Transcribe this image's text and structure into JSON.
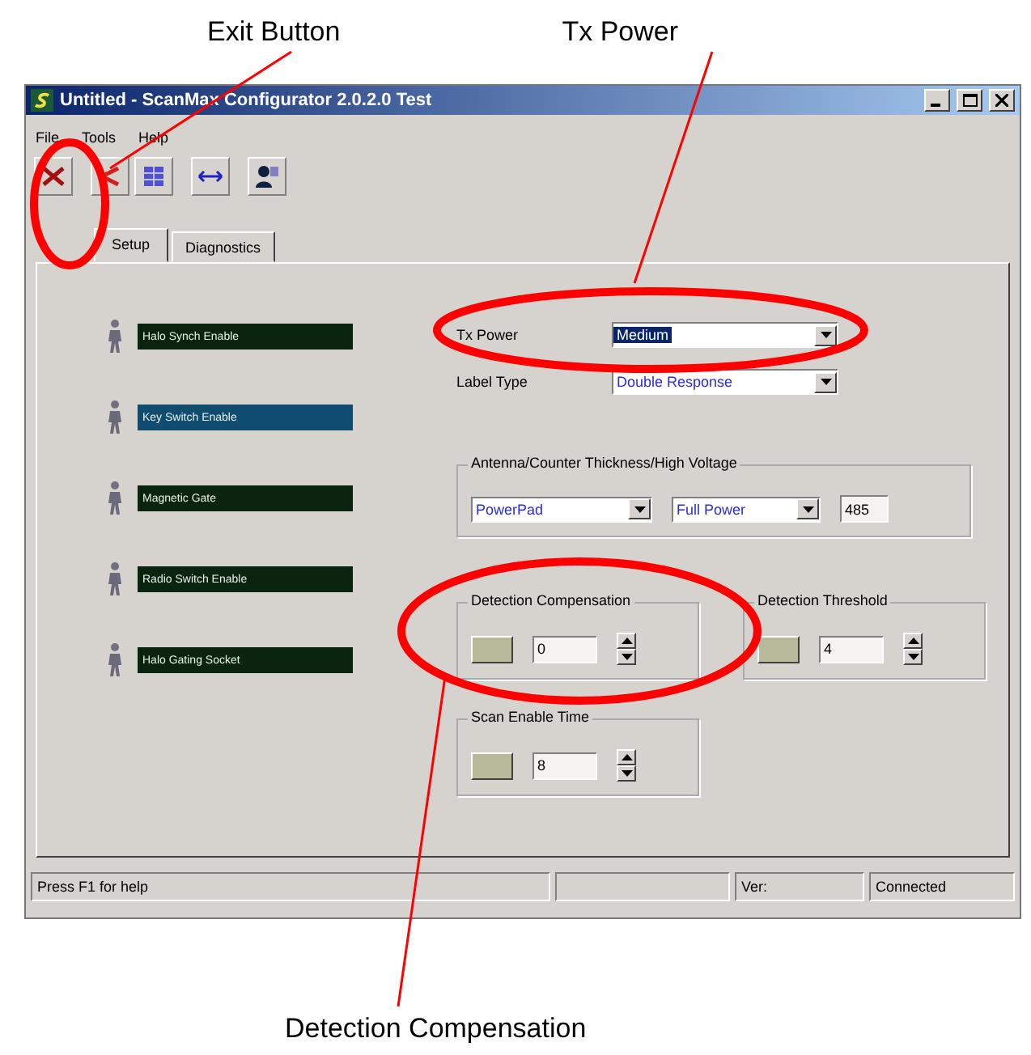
{
  "annotations": [
    {
      "label": "Exit Button"
    },
    {
      "label": "Tx Power"
    },
    {
      "label": "Detection Compensation"
    }
  ],
  "window": {
    "title": "Untitled - ScanMax Configurator 2.0.2.0 Test"
  },
  "menu": [
    "File",
    "Tools",
    "Help"
  ],
  "toolbar": [
    {
      "kind": "exit"
    },
    {
      "kind": "red"
    },
    {
      "kind": "blue"
    },
    {
      "kind": "arrows"
    },
    {
      "kind": "user"
    }
  ],
  "tabs": [
    {
      "label": "Setup",
      "selected": true
    },
    {
      "label": "Diagnostics",
      "selected": false
    }
  ],
  "indicators": [
    {
      "label": "Halo Synch Enable",
      "on": false
    },
    {
      "label": "Key Switch Enable",
      "on": true
    },
    {
      "label": "Magnetic Gate",
      "on": false
    },
    {
      "label": "Radio Switch Enable",
      "on": false
    },
    {
      "label": "Halo Gating Socket",
      "on": false
    }
  ],
  "settings": [
    {
      "label": "Tx Power",
      "value": "Medium",
      "focused": true
    },
    {
      "label": "Label Type",
      "value": "Double Response",
      "focused": false
    }
  ],
  "antenna": {
    "title": "Antenna/Counter Thickness/High Voltage",
    "pad": "PowerPad",
    "power": "Full Power",
    "voltage": "485"
  },
  "spinners": [
    {
      "title": "Detection Compensation",
      "value": "0"
    },
    {
      "title": "Detection Threshold",
      "value": "4"
    },
    {
      "title": "Scan Enable Time",
      "value": "8"
    }
  ],
  "status_bar": [
    "Press F1 for help",
    "Ver:",
    "Connected"
  ]
}
